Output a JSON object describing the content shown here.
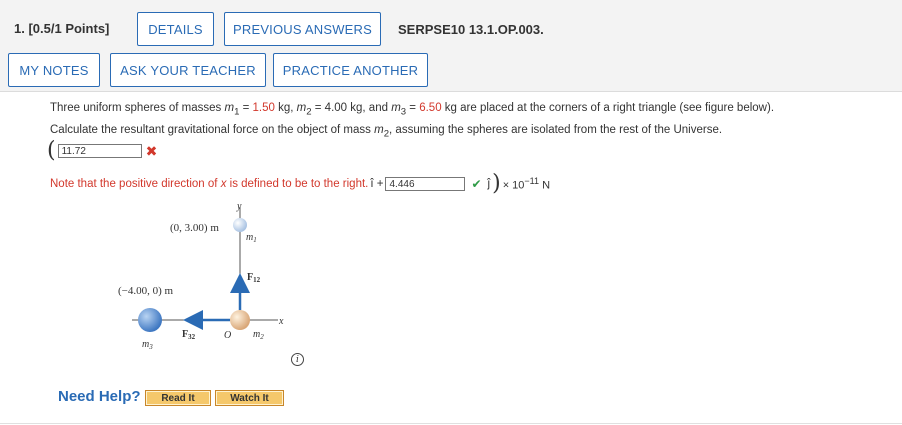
{
  "header": {
    "question_number": "1.",
    "points": "[0.5/1 Points]",
    "details_label": "DETAILS",
    "previous_answers_label": "PREVIOUS ANSWERS",
    "question_id": "SERPSE10 13.1.OP.003.",
    "my_notes_label": "MY NOTES",
    "ask_teacher_label": "ASK YOUR TEACHER",
    "practice_another_label": "PRACTICE ANOTHER"
  },
  "problem": {
    "line1_a": "Three uniform spheres of masses ",
    "m1_sym": "m",
    "m1_sub": "1",
    "line1_eq1": " = ",
    "m1_value": "1.50",
    "line1_kg1": " kg, ",
    "m2_sym": "m",
    "m2_sub": "2",
    "line1_eq2": " = 4.00 kg, and ",
    "m3_sym": "m",
    "m3_sub": "3",
    "line1_eq3": " = ",
    "m3_value": "6.50",
    "line1_end": " kg are placed at the corners of a right triangle (see figure below).",
    "line2_a": "Calculate the resultant gravitational force on the object of mass ",
    "line2_sym": "m",
    "line2_sub": "2",
    "line2_end": ", assuming the spheres are isolated from the rest of the Universe."
  },
  "answer": {
    "open_paren": "(",
    "i_value": "11.72",
    "i_status": "incorrect",
    "note_a": "Note that the positive direction of ",
    "note_x": "x",
    "note_b": " is defined to be to the right.",
    "i_hat": " î + ",
    "j_value": "4.446",
    "j_status": "correct",
    "j_hat": "ĵ",
    "close_paren": ")",
    "times": " × 10",
    "exponent": "−11",
    "unit": " N"
  },
  "figure": {
    "y_axis_label": "y",
    "x_axis_label": "x",
    "top_coord": "(0, 3.00) m",
    "left_coord": "(−4.00, 0) m",
    "origin_label": "O",
    "m1_label": "m",
    "m1_sub": "1",
    "m2_label": "m",
    "m2_sub": "2",
    "m3_label": "m",
    "m3_sub": "3",
    "f12_label": "F",
    "f12_sub": "12",
    "f32_label": "F",
    "f32_sub": "32",
    "colors": {
      "m1": "#a9c3e3",
      "m2": "#d9a778",
      "m3": "#3f78c2",
      "arrow": "#2a6bb5"
    }
  },
  "help": {
    "need_help": "Need Help?",
    "read_it": "Read It",
    "watch_it": "Watch It"
  },
  "icons": {
    "incorrect": "cross-icon",
    "correct": "check-icon",
    "info": "info-icon"
  }
}
